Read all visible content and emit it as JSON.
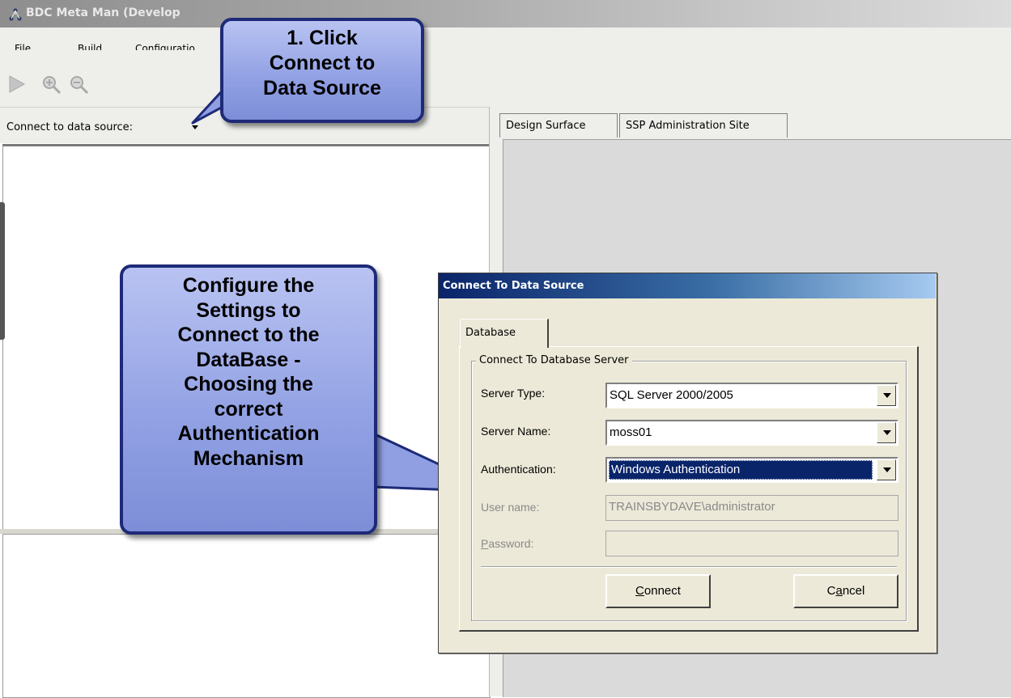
{
  "window": {
    "title": "BDC Meta Man (Develop"
  },
  "menu": {
    "items": [
      {
        "pre": "",
        "ul": "F",
        "post": "ile"
      },
      {
        "pre": "",
        "ul": "B",
        "post": "uild"
      },
      {
        "pre": "",
        "ul": "C",
        "post": "onfiguratio"
      }
    ]
  },
  "toolbar": {
    "icons": [
      "play-icon",
      "zoom-in-icon",
      "zoom-out-icon"
    ]
  },
  "left_panel": {
    "connect_label": "Connect to data source:"
  },
  "right_panel": {
    "tabs": [
      "Design Surface",
      "SSP Administration Site"
    ]
  },
  "callouts": {
    "step1": [
      "1. Click",
      "Connect to",
      "Data Source"
    ],
    "step2": [
      "Configure the",
      "Settings to",
      "Connect to the",
      "DataBase -",
      "Choosing the",
      "correct",
      "Authentication",
      "Mechanism"
    ]
  },
  "dialog": {
    "title": "Connect To Data Source",
    "tab": "Database",
    "group": "Connect To Database  Server",
    "fields": {
      "server_type": {
        "label": "Server Type:",
        "value": "SQL Server 2000/2005"
      },
      "server_name": {
        "label": "Server Name:",
        "value": "moss01"
      },
      "authentication": {
        "label": "Authentication:",
        "value": "Windows Authentication"
      },
      "user_name": {
        "label": "User name:",
        "value": "TRAINSBYDAVE\\administrator"
      },
      "password": {
        "label_ul": "P",
        "label_rest": "assword:",
        "value": ""
      }
    },
    "buttons": {
      "connect": {
        "ul": "C",
        "rest": "onnect"
      },
      "cancel": {
        "pre": "C",
        "ul": "a",
        "rest": "ncel"
      }
    }
  },
  "colors": {
    "callout_border": "#1e2a78",
    "dialog_title_start": "#0a246a",
    "dialog_title_end": "#a6caf0",
    "selection": "#0a246a"
  }
}
